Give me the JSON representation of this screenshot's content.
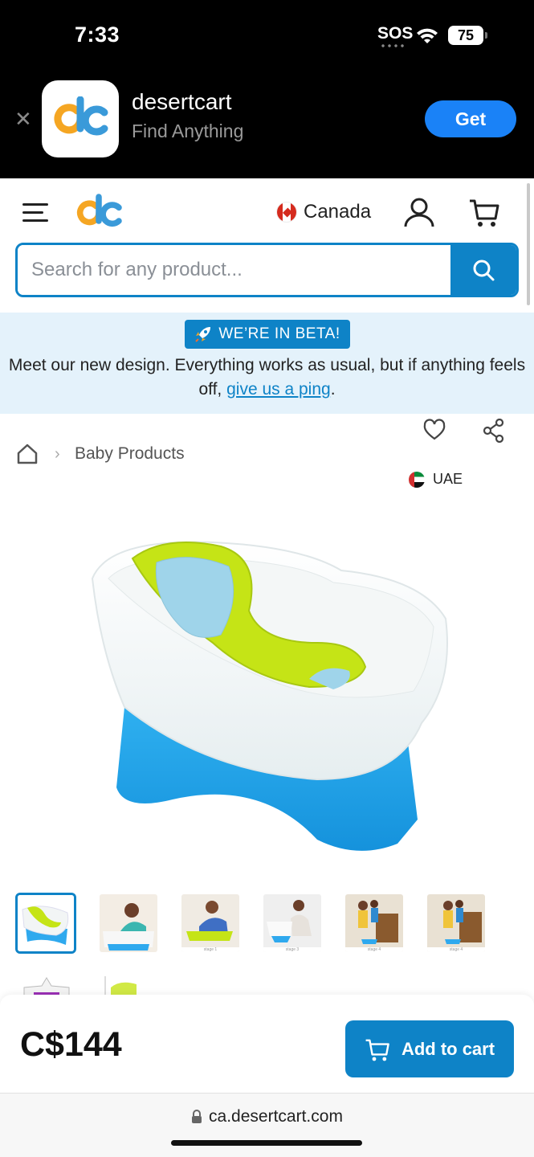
{
  "status_bar": {
    "time": "7:33",
    "carrier": "SOS",
    "battery": "75"
  },
  "app_banner": {
    "app_name": "desertcart",
    "tagline": "Find Anything",
    "get_label": "Get"
  },
  "header": {
    "country": "Canada"
  },
  "search": {
    "placeholder": "Search for any product..."
  },
  "beta_notice": {
    "badge": "WE’RE IN BETA!",
    "text_before": "Meet our new design. Everything works as usual, but if anything feels off, ",
    "link": "give us a ping",
    "text_after": "."
  },
  "breadcrumb": {
    "category": "Baby Products"
  },
  "product": {
    "origin": "UAE",
    "price": "C$144",
    "add_to_cart_label": "Add to cart"
  },
  "thumbnails": [
    {
      "caption": ""
    },
    {
      "caption": ""
    },
    {
      "caption": "stage 1"
    },
    {
      "caption": "stage 3"
    },
    {
      "caption": "stage 4"
    },
    {
      "caption": "stage 4"
    }
  ],
  "browser": {
    "url": "ca.desertcart.com"
  },
  "colors": {
    "brand_blue": "#0e83c7",
    "ios_blue": "#1a82f7",
    "beta_bg": "#e4f2fb"
  }
}
